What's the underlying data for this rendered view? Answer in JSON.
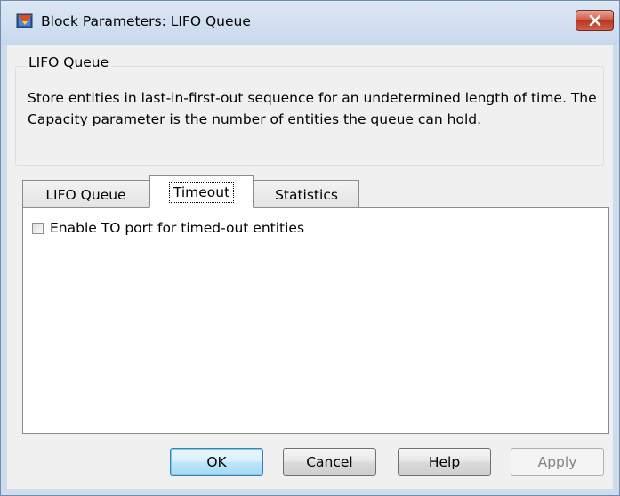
{
  "window": {
    "title": "Block Parameters: LIFO Queue",
    "app_icon": "simulink-block-icon",
    "close_icon": "close-x-icon"
  },
  "group": {
    "legend": "LIFO Queue",
    "description": "Store entities in last-in-first-out sequence for an undetermined length of time. The Capacity parameter is the number of entities the queue can hold."
  },
  "tabs": [
    {
      "label": "LIFO Queue",
      "active": false
    },
    {
      "label": "Timeout",
      "active": true
    },
    {
      "label": "Statistics",
      "active": false
    }
  ],
  "timeout_tab": {
    "enable_to_port": {
      "label": "Enable TO port for timed-out entities",
      "checked": false
    }
  },
  "buttons": {
    "ok": "OK",
    "cancel": "Cancel",
    "help": "Help",
    "apply": "Apply"
  }
}
